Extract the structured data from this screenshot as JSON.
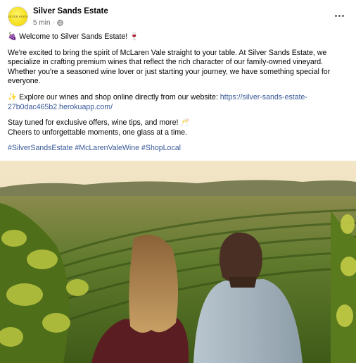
{
  "post": {
    "page_name": "Silver Sands Estate",
    "avatar_text": "SILVER SANDS",
    "time": "5 min",
    "separator": "·",
    "more_icon": "more-horizontal-icon",
    "privacy_icon": "globe-icon",
    "greeting": {
      "emoji_start": "🍇",
      "text": " Welcome to Silver Sands Estate! ",
      "emoji_end": "🍷"
    },
    "intro_lines": [
      "We're excited to bring the spirit of McLaren Vale straight to your table. At Silver Sands Estate, we",
      "specialize in crafting premium wines that reflect the rich character of our family-owned vineyard.",
      "Whether you're a seasoned wine lover or just starting your journey, we have something special for",
      "everyone."
    ],
    "explore": {
      "emoji": "✨",
      "text": " Explore our wines and shop online directly from our website: ",
      "link_part1": "https://silver-sands-estate-",
      "link_part2": "27b0dac465b2.herokuapp.com/"
    },
    "closing_lines": [
      "Stay tuned for exclusive offers, wine tips, and more! 🥂",
      "Cheers to unforgettable moments, one glass at a time."
    ],
    "hashtags": [
      "#SilverSandsEstate",
      "#McLarenValeWine",
      "#ShopLocal"
    ]
  },
  "photo": {
    "description_colors": {
      "sky": "#efe2c2",
      "hills": "#6f7a4a",
      "vines": "#4d6a22",
      "foliage": "#a7b83a"
    }
  },
  "colors": {
    "link": "#385898",
    "secondary_text": "#65676b"
  }
}
